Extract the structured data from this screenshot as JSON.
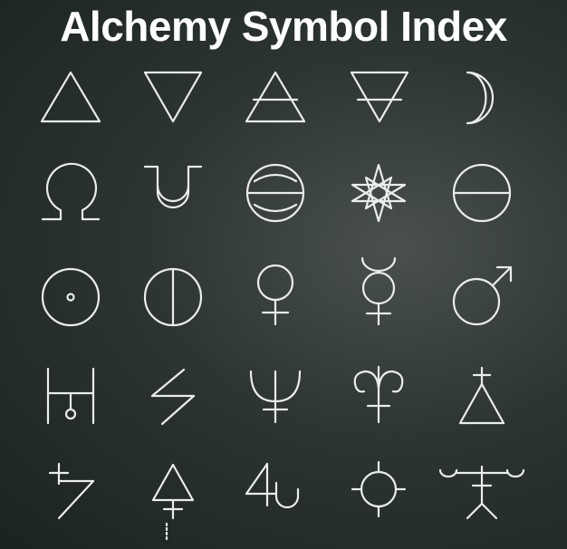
{
  "title": "Alchemy Symbol Index",
  "colors": {
    "symbol_stroke": "#ececec",
    "background": "#2c3434",
    "title": "#ffffff"
  },
  "symbols": [
    "fire-icon",
    "water-icon",
    "air-icon",
    "earth-icon",
    "moon-icon",
    "omega-icon",
    "bell-icon",
    "sphere-icon",
    "star-icon",
    "circle-line-icon",
    "sun-icon",
    "split-circle-icon",
    "venus-icon",
    "mercury-icon",
    "mars-icon",
    "comb-icon",
    "lightning-icon",
    "neptune-icon",
    "curl-icon",
    "triangle-cross-icon",
    "saturn-icon",
    "triangle-arrow-icon",
    "jupiter-icon",
    "circle-cross-icon",
    "figure-icon"
  ]
}
